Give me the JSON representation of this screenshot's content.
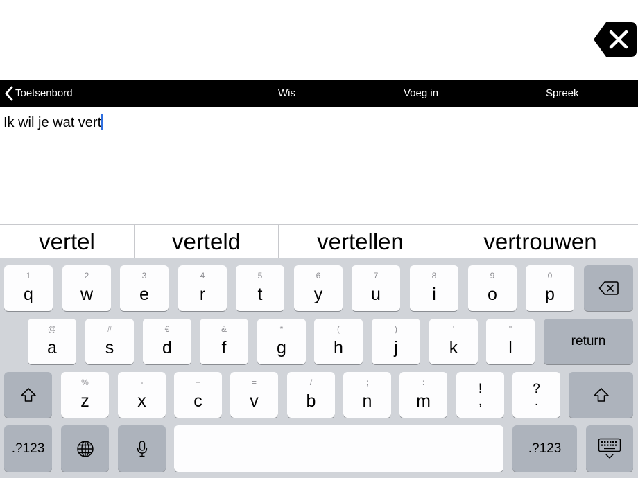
{
  "toolbar": {
    "back_label": "Toetsenbord",
    "clear_label": "Wis",
    "insert_label": "Voeg in",
    "speak_label": "Spreek"
  },
  "editor": {
    "text": "Ik wil je wat vert"
  },
  "suggestions": [
    "vertel",
    "verteld",
    "vertellen",
    "vertrouwen"
  ],
  "keyboard": {
    "row1": [
      {
        "hint": "1",
        "char": "q"
      },
      {
        "hint": "2",
        "char": "w"
      },
      {
        "hint": "3",
        "char": "e"
      },
      {
        "hint": "4",
        "char": "r"
      },
      {
        "hint": "5",
        "char": "t"
      },
      {
        "hint": "6",
        "char": "y"
      },
      {
        "hint": "7",
        "char": "u"
      },
      {
        "hint": "8",
        "char": "i"
      },
      {
        "hint": "9",
        "char": "o"
      },
      {
        "hint": "0",
        "char": "p"
      }
    ],
    "row2": [
      {
        "hint": "@",
        "char": "a"
      },
      {
        "hint": "#",
        "char": "s"
      },
      {
        "hint": "€",
        "char": "d"
      },
      {
        "hint": "&",
        "char": "f"
      },
      {
        "hint": "*",
        "char": "g"
      },
      {
        "hint": "(",
        "char": "h"
      },
      {
        "hint": ")",
        "char": "j"
      },
      {
        "hint": "'",
        "char": "k"
      },
      {
        "hint": "\"",
        "char": "l"
      }
    ],
    "row3": [
      {
        "hint": "%",
        "char": "z"
      },
      {
        "hint": "-",
        "char": "x"
      },
      {
        "hint": "+",
        "char": "c"
      },
      {
        "hint": "=",
        "char": "v"
      },
      {
        "hint": "/",
        "char": "b"
      },
      {
        "hint": ";",
        "char": "n"
      },
      {
        "hint": ":",
        "char": "m"
      }
    ],
    "punct1": {
      "top": "!",
      "bottom": ","
    },
    "punct2": {
      "top": "?",
      "bottom": "."
    },
    "return_label": "return",
    "numbers_label_left": ".?123",
    "numbers_label_right": ".?123"
  },
  "icons": {
    "close": "close-icon",
    "back": "chevron-left-icon",
    "delete": "backspace-icon",
    "shift": "shift-icon",
    "globe": "globe-icon",
    "mic": "microphone-icon",
    "hide_keyboard": "keyboard-dismiss-icon"
  }
}
